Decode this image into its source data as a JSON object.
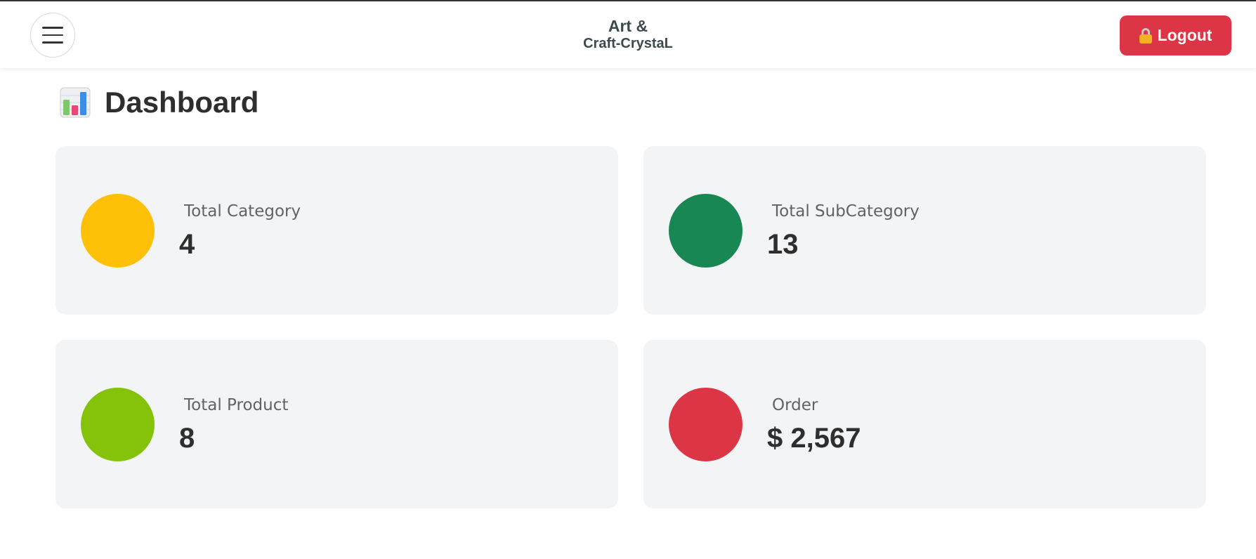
{
  "header": {
    "menu_icon": "hamburger-menu-icon",
    "brand_line1": "Art &",
    "brand_line2": "Craft-CrystaL",
    "logout_label": "Logout",
    "logout_icon": "lock-icon",
    "logout_color": "#dc3545"
  },
  "page": {
    "title": "Dashboard",
    "title_icon": "bar-chart-icon"
  },
  "cards": [
    {
      "label": "Total Category",
      "value": "4",
      "color": "#ffc107"
    },
    {
      "label": "Total SubCategory",
      "value": "13",
      "color": "#198754"
    },
    {
      "label": "Total Product",
      "value": "8",
      "color": "#84c30a"
    },
    {
      "label": "Order",
      "value": "$ 2,567",
      "color": "#dc3545"
    }
  ]
}
